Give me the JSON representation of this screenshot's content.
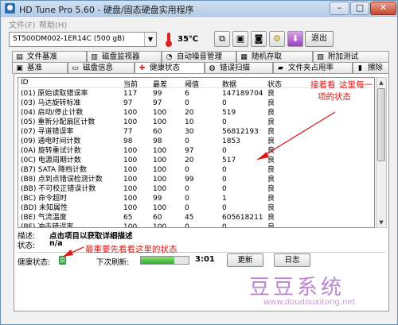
{
  "window": {
    "title": "HD Tune Pro 5.60 - 硬盘/固态硬盘实用程序",
    "title_icon": "hdtune-app-icon",
    "controls": {
      "minimize": "–",
      "maximize": "□",
      "close": "✕"
    }
  },
  "menu": {
    "file": "文件(F)",
    "help": "帮助(H)"
  },
  "toolbar": {
    "drive": "ST500DM002-1ER14C (500 gB)",
    "temperature": "35℃",
    "tool_icons": [
      "copy-icon",
      "save-icon",
      "camera-icon",
      "options-icon",
      "download-icon"
    ],
    "exit_label": "退出"
  },
  "tabs_row1": [
    {
      "label": "文件基准",
      "icon": "file-benchmark-icon",
      "glyph": "▤"
    },
    {
      "label": "磁盘监视器",
      "icon": "disk-monitor-icon",
      "glyph": "▥"
    },
    {
      "label": "自动噪音管理",
      "icon": "noise-icon",
      "glyph": "◔"
    },
    {
      "label": "随机存取",
      "icon": "random-access-icon",
      "glyph": "▦"
    },
    {
      "label": "附加测试",
      "icon": "extra-tests-icon",
      "glyph": "▧"
    }
  ],
  "tabs_row2": [
    {
      "label": "基准",
      "icon": "benchmark-icon",
      "glyph": "▣"
    },
    {
      "label": "磁盘信息",
      "icon": "disk-info-icon",
      "glyph": "▭"
    },
    {
      "label": "健康状态",
      "icon": "health-cross-icon",
      "glyph": "✚"
    },
    {
      "label": "错误扫描",
      "icon": "error-scan-icon",
      "glyph": "◍"
    },
    {
      "label": "文件夹占用率",
      "icon": "folder-usage-icon",
      "glyph": "▰"
    },
    {
      "label": "擦除",
      "icon": "erase-icon",
      "glyph": "▮"
    }
  ],
  "grid": {
    "headers": [
      "ID",
      "当前",
      "最差",
      "阈值",
      "数据",
      "状态"
    ],
    "rows": [
      [
        "(01) 原始读取错误率",
        "117",
        "99",
        "6",
        "147189704",
        "良"
      ],
      [
        "(03) 马达旋转标准",
        "97",
        "97",
        "0",
        "0",
        "良"
      ],
      [
        "(04) 启动/停止计数",
        "100",
        "100",
        "20",
        "519",
        "良"
      ],
      [
        "(05) 重新分配扇区计数",
        "100",
        "100",
        "10",
        "0",
        "良"
      ],
      [
        "(07) 寻道错误率",
        "77",
        "60",
        "30",
        "56812193",
        "良"
      ],
      [
        "(09) 通电时间计数",
        "98",
        "98",
        "0",
        "1853",
        "良"
      ],
      [
        "(0A) 旋转重试计数",
        "100",
        "100",
        "97",
        "0",
        "良"
      ],
      [
        "(0C) 电源周期计数",
        "100",
        "100",
        "20",
        "517",
        "良"
      ],
      [
        "(B7) SATA 降档计数",
        "100",
        "100",
        "0",
        "0",
        "良"
      ],
      [
        "(B8) 点到点错误检测计数",
        "100",
        "100",
        "99",
        "0",
        "良"
      ],
      [
        "(BB) 不可校正错误计数",
        "100",
        "100",
        "0",
        "0",
        "良"
      ],
      [
        "(BC) 命令超时",
        "100",
        "99",
        "0",
        "1",
        "良"
      ],
      [
        "(BD) 未知属性",
        "100",
        "100",
        "0",
        "0",
        "良"
      ],
      [
        "(BE) 气流温度",
        "65",
        "60",
        "45",
        "605618211",
        "良"
      ],
      [
        "(BF) 冲击错误率",
        "100",
        "100",
        "0",
        "0",
        "良"
      ],
      [
        "(C0) 断电收缩计数",
        "100",
        "100",
        "0",
        "0",
        "良"
      ]
    ]
  },
  "description": {
    "label": "描述:",
    "value": "点击项目以获取详细描述",
    "status_label": "状态:",
    "status_value": "n/a"
  },
  "footer": {
    "health_label": "健康状态:",
    "health_glyph": "良",
    "refresh_label": "下次刷新:",
    "refresh_progress": 0.7,
    "countdown": "3:01",
    "update_button": "更新",
    "log_button": "日志"
  },
  "annotations": {
    "top_right": [
      "这里每一",
      "项的状态"
    ],
    "top_right_lead": "接着看",
    "bottom": "最重要先看看这里的状态",
    "color": "#e01818"
  },
  "watermark": {
    "text": "豆豆系统",
    "url": "www.doudouxitong.net"
  }
}
